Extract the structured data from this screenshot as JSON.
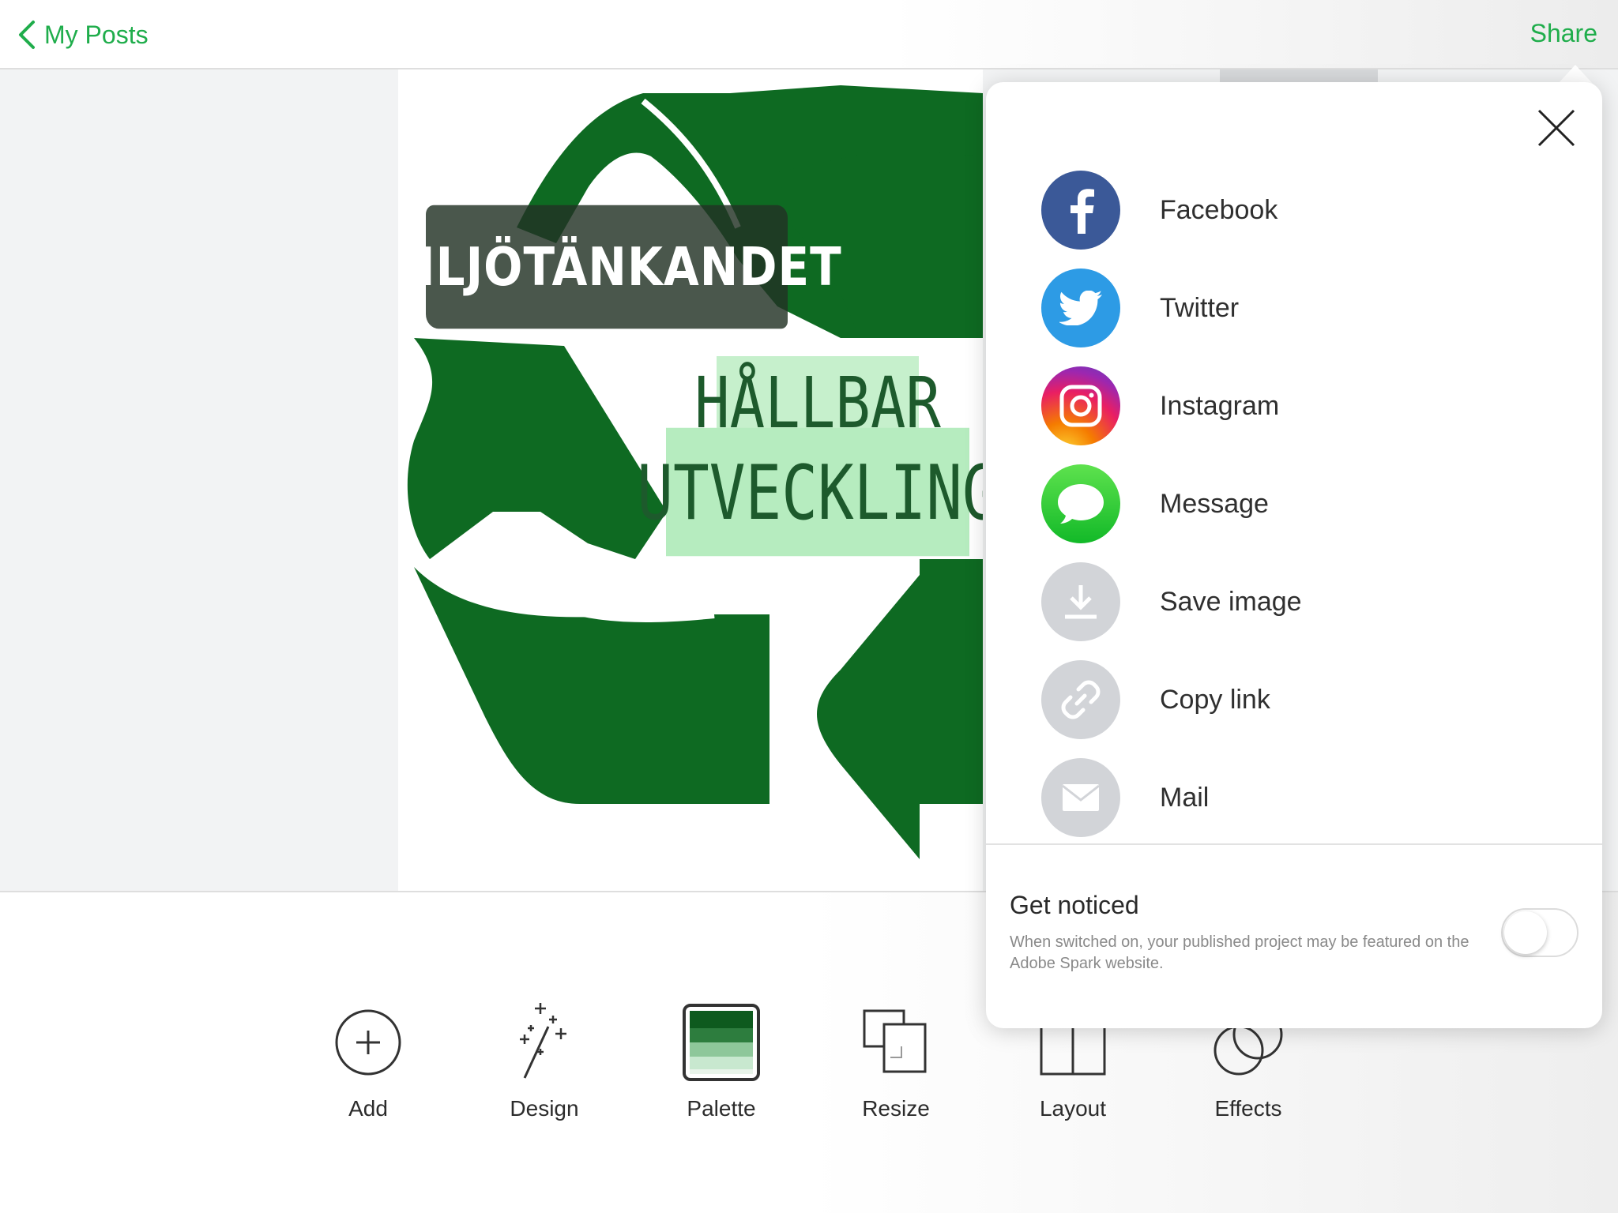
{
  "topbar": {
    "back_label": "My Posts",
    "share_label": "Share"
  },
  "post": {
    "title": "MILJÖTÄNKANDET",
    "subtitle_line1": "HÅLLBAR",
    "subtitle_line2": "UTVECKLING",
    "colors": {
      "recycle_green": "#0e6a22",
      "title_bg": "#2a3a2c",
      "subtitle_bg": "#c6f0cc"
    }
  },
  "share_panel": {
    "items": [
      {
        "label": "Facebook",
        "icon": "facebook-icon",
        "color": "#3b5998"
      },
      {
        "label": "Twitter",
        "icon": "twitter-icon",
        "color": "#2d9be5"
      },
      {
        "label": "Instagram",
        "icon": "instagram-icon",
        "color": "#c13584"
      },
      {
        "label": "Message",
        "icon": "message-icon",
        "color": "#27c93f"
      },
      {
        "label": "Save image",
        "icon": "download-icon",
        "color": "#d2d4d8"
      },
      {
        "label": "Copy link",
        "icon": "link-icon",
        "color": "#d2d4d8"
      },
      {
        "label": "Mail",
        "icon": "mail-icon",
        "color": "#d2d4d8"
      }
    ],
    "notice": {
      "title": "Get noticed",
      "description": "When switched on, your published project may be featured on the Adobe Spark website.",
      "toggle_on": false
    }
  },
  "toolbar": {
    "items": [
      {
        "label": "Add",
        "icon": "add-icon"
      },
      {
        "label": "Design",
        "icon": "magic-wand-icon"
      },
      {
        "label": "Palette",
        "icon": "palette-icon"
      },
      {
        "label": "Resize",
        "icon": "resize-icon"
      },
      {
        "label": "Layout",
        "icon": "layout-icon"
      },
      {
        "label": "Effects",
        "icon": "effects-icon"
      }
    ]
  },
  "accent_color": "#1fad4b"
}
